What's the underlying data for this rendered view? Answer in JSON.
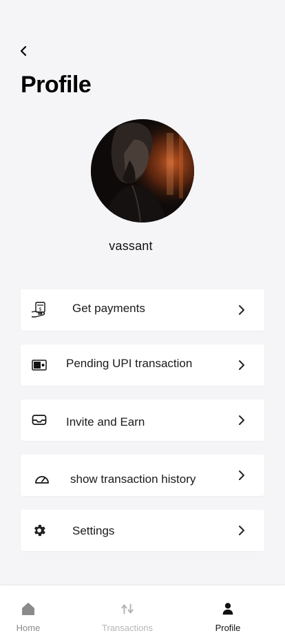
{
  "header": {
    "title": "Profile"
  },
  "profile": {
    "username": "vassant"
  },
  "menu": {
    "items": [
      {
        "label": "Get payments",
        "icon": "hand-money-icon"
      },
      {
        "label": "Pending UPI transaction",
        "icon": "wallet-icon"
      },
      {
        "label": "Invite and Earn",
        "icon": "envelope-icon"
      },
      {
        "label": "show transaction history",
        "icon": "speedometer-icon"
      },
      {
        "label": "Settings",
        "icon": "gear-icon"
      }
    ]
  },
  "tabbar": {
    "tabs": [
      {
        "label": "Home",
        "icon": "home-icon",
        "active": false
      },
      {
        "label": "Transactions",
        "icon": "transfer-arrows-icon",
        "active": false
      },
      {
        "label": "Profile",
        "icon": "person-icon",
        "active": true
      }
    ]
  },
  "colors": {
    "background": "#f5f5f7",
    "card": "#ffffff",
    "active_tab": "#111111",
    "inactive_tab_home": "#8a8a8a",
    "inactive_tab_transactions": "#b5b5b5"
  }
}
